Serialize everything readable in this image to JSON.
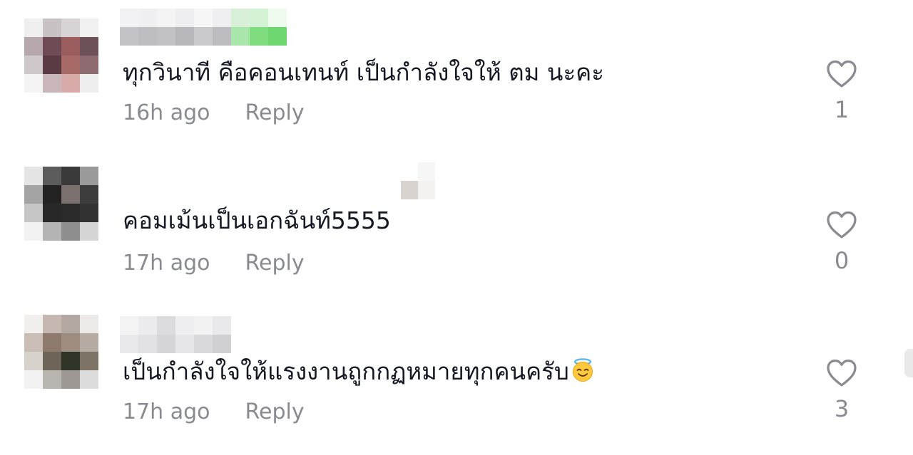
{
  "comments": [
    {
      "text": "ทุกวินาที คือคอนเทนท์ เป็นกำลังใจให้ ตม นะคะ",
      "time": "16h ago",
      "reply_label": "Reply",
      "like_count": "1",
      "avatar_icon": "blurred-avatar",
      "avatar_colors": [
        "#efefef",
        "#c9c2c4",
        "#d8d4d6",
        "#f1f1f1",
        "#b6a8ad",
        "#6e4b55",
        "#9a5c5d",
        "#6b5058",
        "#cfc8ca",
        "#5b3b43",
        "#a86a66",
        "#8e6b70",
        "#f4f4f4",
        "#c8b6b8",
        "#d9aba9",
        "#eeeeee"
      ],
      "username_colors": [
        "#f2f2f4",
        "#c4c4c8",
        "#f0f0f2",
        "#bebec2",
        "#f4f4f5",
        "#c2c2c6",
        "#eeeef0",
        "#b8b8bc",
        "#f6f6f7",
        "#cacace",
        "#efeff1",
        "#bcbcc0",
        "#d8efd8",
        "#a9e6a9",
        "#d4f3d4",
        "#7fdc7f",
        "#f0fbf0",
        "#6fd76f"
      ]
    },
    {
      "text": "คอมเม้นเป็นเอกฉันท์5555",
      "time": "17h ago",
      "reply_label": "Reply",
      "like_count": "0",
      "avatar_icon": "blurred-avatar",
      "avatar_colors": [
        "#e4e4e4",
        "#5c5c5c",
        "#3a3a3a",
        "#9a9a9a",
        "#a4a4a4",
        "#222222",
        "#7a706e",
        "#3c3c3c",
        "#c6c6c6",
        "#282828",
        "#2a2a2a",
        "#323232",
        "#f2f2f2",
        "#b4b4b4",
        "#8e8e8e",
        "#d6d6d6"
      ],
      "username_colors": []
    },
    {
      "text": "เป็นกำลังใจให้แรงงานถูกกฏหมายทุกคนครับ",
      "time": "17h ago",
      "reply_label": "Reply",
      "like_count": "3",
      "avatar_icon": "blurred-avatar",
      "avatar_colors": [
        "#f2f0ef",
        "#c6b8b0",
        "#b3a8a2",
        "#ecebea",
        "#c9bdb5",
        "#8e7a6c",
        "#9e8c7e",
        "#b7aca4",
        "#d8d2cd",
        "#6d6658",
        "#2e3526",
        "#7e7466",
        "#f2f2f2",
        "#b8b4b0",
        "#9e9894",
        "#dcdcdc"
      ],
      "username_colors": [
        "#f3f3f4",
        "#e8e8ea",
        "#ececee",
        "#e2e2e4",
        "#dcdcde",
        "#d6d6d8",
        "#eeeef0",
        "#e6e6e8",
        "#f2f2f3",
        "#dadadc",
        "#e9e9eb",
        "#d0d0d3"
      ]
    }
  ],
  "colors": {
    "text_primary": "#161823",
    "text_secondary": "#8a8b91"
  },
  "icons": {
    "like": "heart-outline-icon",
    "emoji": "smiling-face-with-halo-icon"
  }
}
